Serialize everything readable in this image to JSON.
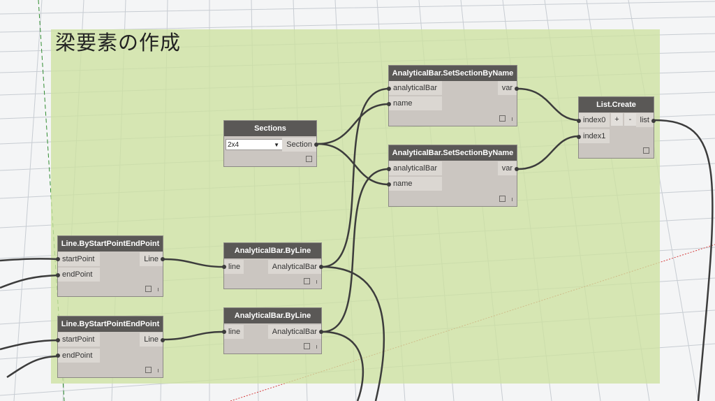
{
  "group": {
    "title": "梁要素の作成",
    "color": "#cde2a0"
  },
  "nodes": {
    "sections": {
      "title": "Sections",
      "selected": "2x4",
      "output": "Section"
    },
    "set_section_1": {
      "title": "AnalyticalBar.SetSectionByName",
      "in0": "analyticalBar",
      "in1": "name",
      "output": "var"
    },
    "set_section_2": {
      "title": "AnalyticalBar.SetSectionByName",
      "in0": "analyticalBar",
      "in1": "name",
      "output": "var"
    },
    "list_create": {
      "title": "List.Create",
      "in0": "index0",
      "in1": "index1",
      "add": "+",
      "remove": "-",
      "output": "list"
    },
    "line_1": {
      "title": "Line.ByStartPointEndPoint",
      "in0": "startPoint",
      "in1": "endPoint",
      "output": "Line"
    },
    "line_2": {
      "title": "Line.ByStartPointEndPoint",
      "in0": "startPoint",
      "in1": "endPoint",
      "output": "Line"
    },
    "bar_1": {
      "title": "AnalyticalBar.ByLine",
      "in0": "line",
      "output": "AnalyticalBar"
    },
    "bar_2": {
      "title": "AnalyticalBar.ByLine",
      "in0": "line",
      "output": "AnalyticalBar"
    }
  },
  "colors": {
    "node_header": "#5a5856",
    "node_body": "#cbc6c1",
    "wire": "#3c3c3c"
  }
}
